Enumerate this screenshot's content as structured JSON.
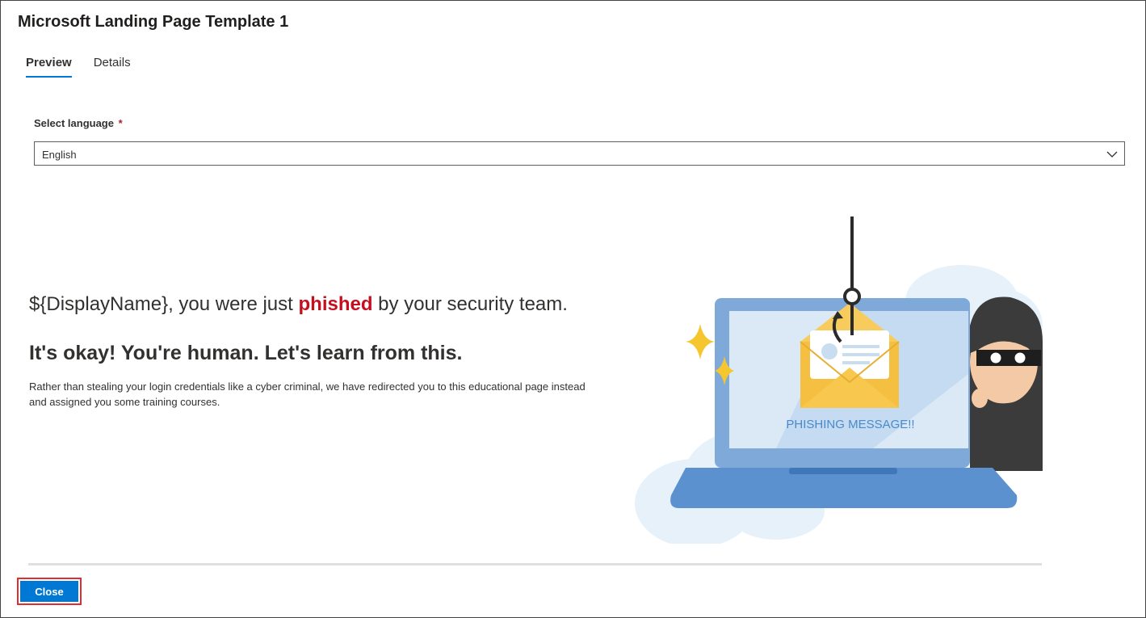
{
  "panel": {
    "title": "Microsoft Landing Page Template 1"
  },
  "tabs": [
    {
      "label": "Preview",
      "active": true
    },
    {
      "label": "Details",
      "active": false
    }
  ],
  "language": {
    "label": "Select language",
    "required_mark": "*",
    "selected": "English"
  },
  "preview": {
    "headline_prefix": "${DisplayName}, you were just ",
    "headline_highlight": "phished",
    "headline_suffix": " by your security team.",
    "subheadline": "It's okay! You're human. Let's learn from this.",
    "body_line1": "Rather than stealing your login credentials like a cyber criminal, we have redirected you to this educational page instead",
    "body_line2": "and assigned you some training courses.",
    "illustration_text": "PHISHING MESSAGE!!"
  },
  "footer": {
    "close_label": "Close"
  },
  "colors": {
    "accent": "#0078d4",
    "highlight": "#c50f1f",
    "required": "#a4262c",
    "focus_outline": "#e02e2e"
  }
}
